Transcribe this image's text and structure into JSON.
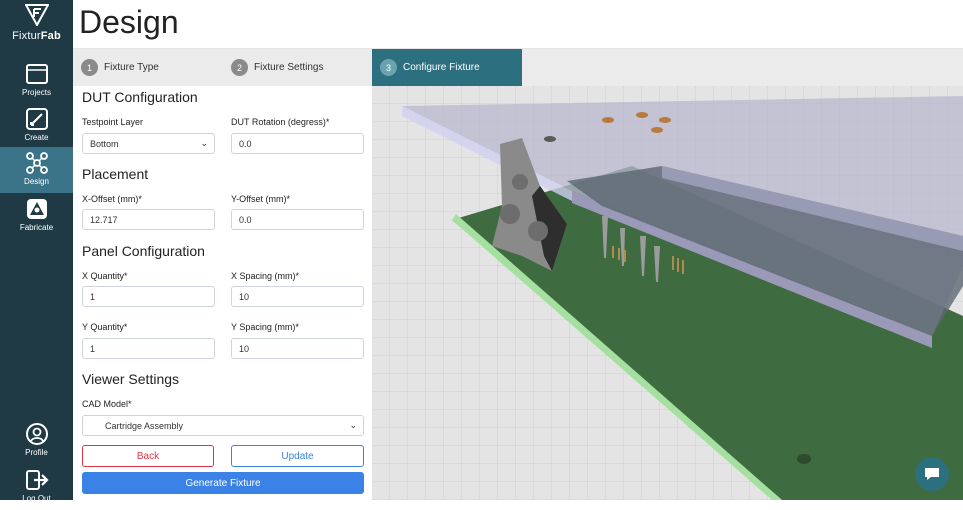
{
  "app": {
    "brand_light": "Fixtur",
    "brand_bold": "Fab"
  },
  "sidebar": {
    "items": [
      {
        "label": "Projects",
        "icon": "folder-icon"
      },
      {
        "label": "Create",
        "icon": "pencil-icon"
      },
      {
        "label": "Design",
        "icon": "network-icon",
        "active": true
      },
      {
        "label": "Fabricate",
        "icon": "printer-icon"
      }
    ],
    "bottom": [
      {
        "label": "Profile",
        "icon": "user-circle-icon"
      },
      {
        "label": "Log Out",
        "icon": "logout-icon"
      }
    ]
  },
  "header": {
    "title": "Design"
  },
  "steps": [
    {
      "num": "1",
      "label": "Fixture Type"
    },
    {
      "num": "2",
      "label": "Fixture Settings"
    },
    {
      "num": "3",
      "label": "Configure Fixture",
      "active": true
    }
  ],
  "form": {
    "dut": {
      "heading": "DUT Configuration",
      "testpoint_label": "Testpoint Layer",
      "testpoint_value": "Bottom",
      "rotation_label": "DUT Rotation (degress)*",
      "rotation_value": "0.0"
    },
    "placement": {
      "heading": "Placement",
      "x_label": "X-Offset (mm)*",
      "x_value": "12.717",
      "y_label": "Y-Offset (mm)*",
      "y_value": "0.0"
    },
    "panel": {
      "heading": "Panel Configuration",
      "xq_label": "X Quantity*",
      "xq_value": "1",
      "xs_label": "X Spacing (mm)*",
      "xs_value": "10",
      "yq_label": "Y Quantity*",
      "yq_value": "1",
      "ys_label": "Y Spacing (mm)*",
      "ys_value": "10"
    },
    "viewer": {
      "heading": "Viewer Settings",
      "cad_label": "CAD Model*",
      "cad_value": "Cartridge Assembly"
    },
    "buttons": {
      "back": "Back",
      "update": "Update",
      "generate": "Generate Fixture"
    }
  },
  "colors": {
    "sidebar": "#1f3a45",
    "active_nav": "#3b7488",
    "active_step": "#2c6f7e",
    "primary": "#3b82e6",
    "danger": "#dc3545"
  }
}
